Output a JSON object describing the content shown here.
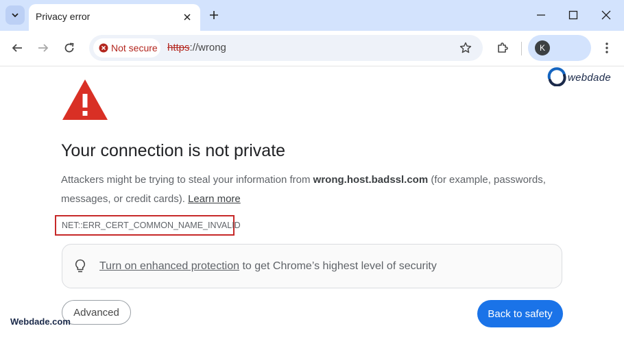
{
  "tab": {
    "title": "Privacy error"
  },
  "omnibox": {
    "security_chip": "Not secure",
    "url_scheme": "https",
    "url_rest": "://wrong"
  },
  "profile": {
    "initial": "K"
  },
  "logo": {
    "text": "webdade"
  },
  "page": {
    "heading": "Your connection is not private",
    "desc_part1": "Attackers might be trying to steal your information from ",
    "desc_host": "wrong.host.badssl.com",
    "desc_part2": " (for example, passwords, messages, or credit cards). ",
    "learn_more": "Learn more",
    "error_code": "NET::ERR_CERT_COMMON_NAME_INVALID",
    "enhanced_link": "Turn on enhanced protection",
    "enhanced_rest": " to get Chrome’s highest level of security",
    "advanced_label": "Advanced",
    "back_label": "Back to safety"
  },
  "watermark": {
    "text": "Webdade.com"
  },
  "colors": {
    "accent": "#1a73e8",
    "danger": "#d93025",
    "tabstrip": "#d3e3fd"
  }
}
